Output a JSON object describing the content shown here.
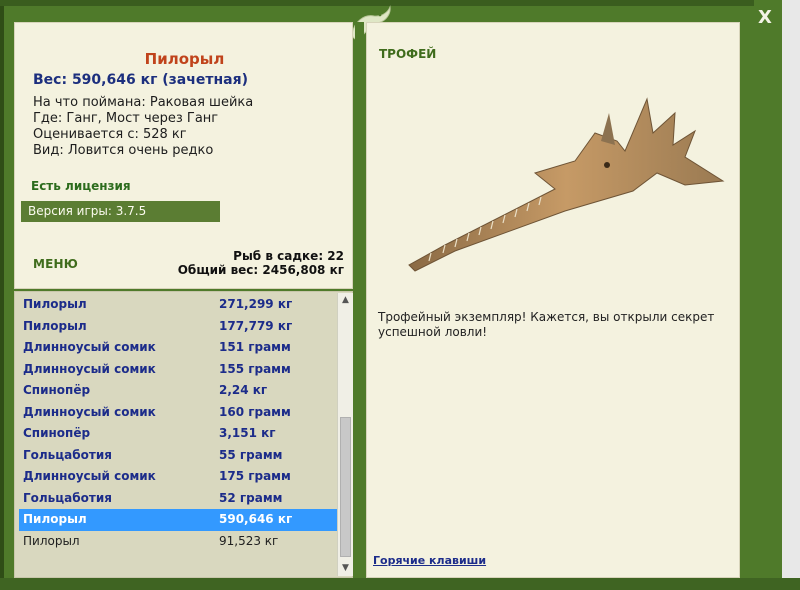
{
  "window": {
    "close_label": "X"
  },
  "fish_card": {
    "name": "Пилорыл",
    "weight": "Вес: 590,646 кг (зачетная)",
    "details": [
      "На что поймана: Раковая шейка",
      "Где: Ганг, Мост через Ганг",
      "Оценивается с: 528 кг",
      "Вид: Ловится очень редко"
    ],
    "license": "Есть лицензия",
    "version": "Версия игры: 3.7.5"
  },
  "menu_label": "МЕНЮ",
  "keepnet": {
    "count": "Рыб в садке: 22",
    "total_weight": "Общий вес: 2456,808 кг"
  },
  "catch_list": [
    {
      "name": "Пилорыл",
      "weight": "271,299 кг"
    },
    {
      "name": "Пилорыл",
      "weight": "177,779 кг"
    },
    {
      "name": "Длинноусый сомик",
      "weight": "151 грамм"
    },
    {
      "name": "Длинноусый сомик",
      "weight": "155 грамм"
    },
    {
      "name": "Спинопёр",
      "weight": "2,24 кг"
    },
    {
      "name": "Длинноусый сомик",
      "weight": "160 грамм"
    },
    {
      "name": "Спинопёр",
      "weight": "3,151 кг"
    },
    {
      "name": "Гольцаботия",
      "weight": "55 грамм"
    },
    {
      "name": "Длинноусый сомик",
      "weight": "175 грамм"
    },
    {
      "name": "Гольцаботия",
      "weight": "52 грамм"
    },
    {
      "name": "Пилорыл",
      "weight": "590,646 кг"
    },
    {
      "name": "Пилорыл",
      "weight": "91,523 кг"
    }
  ],
  "selected_index": 10,
  "trophy_panel": {
    "title": "ТРОФЕЙ",
    "description": "Трофейный экземпляр! Кажется, вы открыли секрет успешной ловли!",
    "hotkeys_link": "Горячие клавиши"
  },
  "colors": {
    "frame_green": "#4f7a2a",
    "panel_cream": "#f4f2df",
    "fish_name_red": "#c0431b",
    "link_blue": "#1c2c8a",
    "selection_blue": "#3399ff"
  },
  "icons": [
    "dragon-emblem-icon",
    "close-icon",
    "scroll-up-icon",
    "scroll-down-icon"
  ]
}
